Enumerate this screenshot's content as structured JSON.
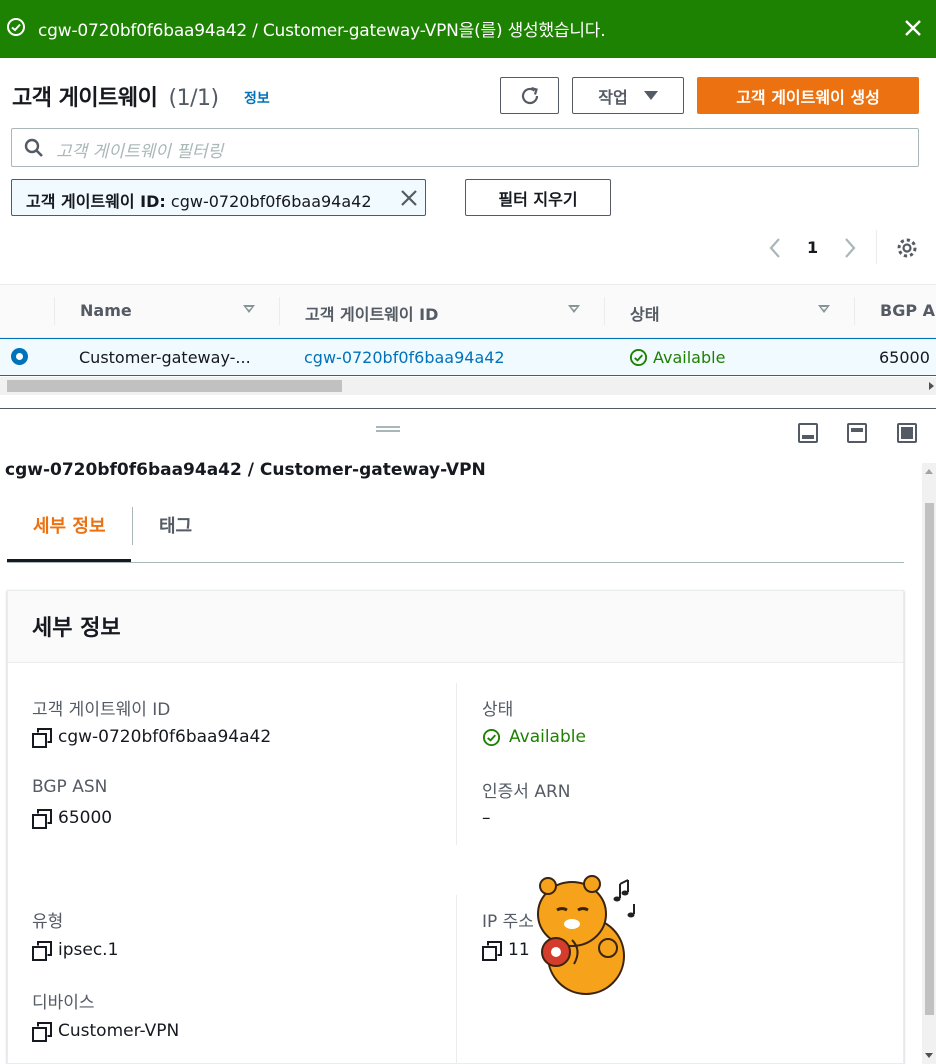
{
  "flash": {
    "message": "cgw-0720bf0f6baa94a42 / Customer-gateway-VPN을(를) 생성했습니다."
  },
  "header": {
    "title": "고객 게이트웨이",
    "count": "(1/1)",
    "info_link": "정보",
    "actions_label": "작업",
    "create_label": "고객 게이트웨이 생성"
  },
  "filter": {
    "placeholder": "고객 게이트웨이 필터링",
    "token_key": "고객 게이트웨이 ID:",
    "token_value": "cgw-0720bf0f6baa94a42",
    "clear_label": "필터 지우기"
  },
  "pagination": {
    "current_page": "1"
  },
  "table": {
    "columns": [
      "Name",
      "고객 게이트웨이 ID",
      "상태",
      "BGP ASN"
    ],
    "rows": [
      {
        "name": "Customer-gateway-...",
        "id": "cgw-0720bf0f6baa94a42",
        "status": "Available",
        "bgp_asn": "65000"
      }
    ]
  },
  "split_panel": {
    "title": "cgw-0720bf0f6baa94a42 / Customer-gateway-VPN",
    "tabs": [
      "세부 정보",
      "태그"
    ],
    "card_title": "세부 정보",
    "fields": {
      "id_label": "고객 게이트웨이 ID",
      "id_value": "cgw-0720bf0f6baa94a42",
      "state_label": "상태",
      "state_value": "Available",
      "asn_label": "BGP ASN",
      "asn_value": "65000",
      "cert_label": "인증서 ARN",
      "cert_value": "–",
      "type_label": "유형",
      "type_value": "ipsec.1",
      "ip_label": "IP 주소",
      "ip_value": "11",
      "device_label": "디바이스",
      "device_value": "Customer-VPN"
    }
  },
  "colors": {
    "success": "#1d8102",
    "primary": "#ec7211",
    "link": "#0073bb",
    "text": "#16191f",
    "secondary_text": "#545b64"
  },
  "icons": [
    "check-circle-icon",
    "close-icon",
    "refresh-icon",
    "caret-down-icon",
    "search-icon",
    "chevron-left-icon",
    "chevron-right-icon",
    "settings-icon",
    "sort-icon",
    "copy-icon",
    "drag-handle-icon",
    "panel-position-icon"
  ]
}
